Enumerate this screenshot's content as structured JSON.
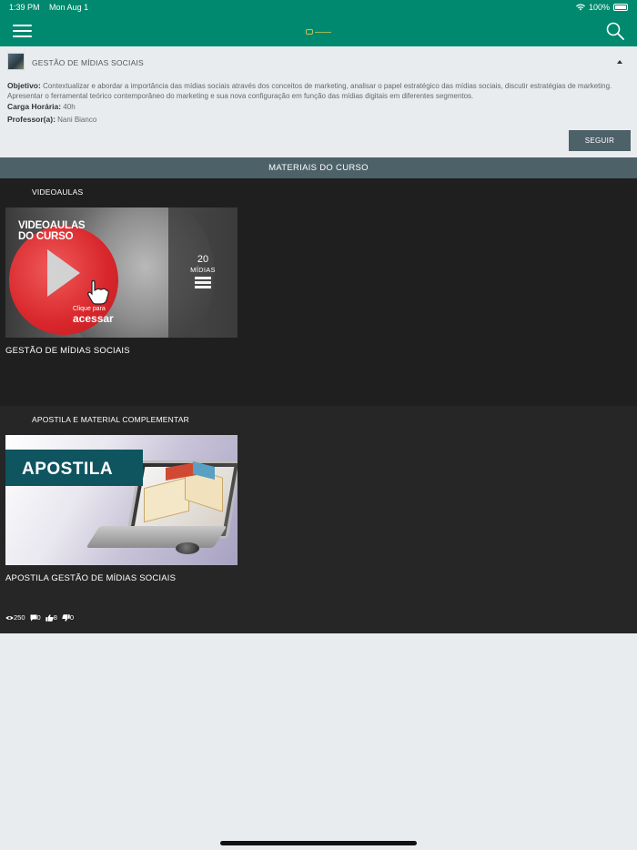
{
  "status_bar": {
    "time": "1:39 PM",
    "date": "Mon Aug 1",
    "battery": "100%"
  },
  "header": {
    "menu_icon": "hamburger-icon",
    "search_icon": "search-icon"
  },
  "course": {
    "title": "GESTÃO DE MÍDIAS SOCIAIS",
    "objective_label": "Objetivo:",
    "objective_text": "Contextualizar e abordar a importância das mídias sociais através dos conceitos de marketing, analisar o papel estratégico das mídias sociais, discutir estratégias de marketing. Apresentar o ferramental teórico contemporâneo do marketing e sua nova configuração em função das mídias digitais em diferentes segmentos.",
    "workload_label": "Carga Horária:",
    "workload_value": "40h",
    "teacher_label": "Professor(a):",
    "teacher_value": "Nani Bianco",
    "follow_label": "SEGUIR"
  },
  "materials_header": "MATERIAIS DO CURSO",
  "sections": {
    "videos": {
      "title": "VIDEOAULAS",
      "thumb_title_line1": "VIDEOAULAS",
      "thumb_title_line2": "DO CURSO",
      "thumb_cta_small": "Clique para",
      "thumb_cta_big": "acessar",
      "media_count": "20",
      "media_count_label": "MÍDIAS",
      "item_name": "GESTÃO DE MÍDIAS SOCIAIS"
    },
    "apostila": {
      "title": "APOSTILA E MATERIAL COMPLEMENTAR",
      "thumb_banner": "APOSTILA",
      "item_name": "APOSTILA GESTÃO DE MÍDIAS SOCIAIS",
      "stats": {
        "views": "250",
        "comments": "0",
        "likes": "8",
        "dislikes": "0"
      }
    }
  },
  "colors": {
    "header": "#00896f",
    "accent_bar": "#4d6169",
    "section_bg": "#1f1f1f",
    "page_bg": "#e9ecef"
  }
}
